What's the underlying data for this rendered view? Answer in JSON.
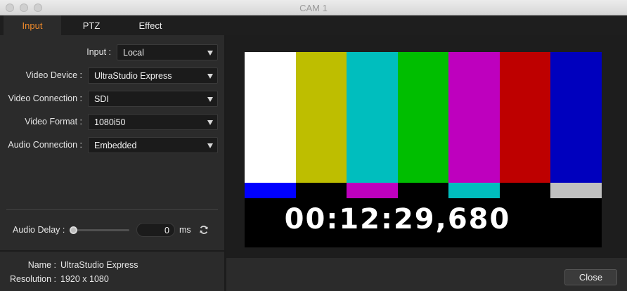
{
  "window": {
    "title": "CAM 1"
  },
  "tabs": [
    {
      "label": "Input",
      "active": true
    },
    {
      "label": "PTZ",
      "active": false
    },
    {
      "label": "Effect",
      "active": false
    }
  ],
  "form": {
    "input": {
      "label": "Input :",
      "value": "Local"
    },
    "video_device": {
      "label": "Video Device :",
      "value": "UltraStudio Express"
    },
    "video_connection": {
      "label": "Video Connection :",
      "value": "SDI"
    },
    "video_format": {
      "label": "Video Format :",
      "value": "1080i50"
    },
    "audio_connection": {
      "label": "Audio Connection :",
      "value": "Embedded"
    }
  },
  "audio_delay": {
    "label": "Audio Delay :",
    "value": "0",
    "unit": "ms"
  },
  "info": {
    "name_label": "Name :",
    "name_value": "UltraStudio Express",
    "resolution_label": "Resolution :",
    "resolution_value": "1920 x 1080"
  },
  "preview": {
    "timecode": "00:12:29,680",
    "top_bars": [
      "#ffffff",
      "#bebe00",
      "#00bebe",
      "#00be00",
      "#be00be",
      "#be0000",
      "#0000be"
    ],
    "bottom_bars": [
      "#0000ff",
      "#000000",
      "#be00be",
      "#000000",
      "#00bebe",
      "#000000",
      "#c0c0c0"
    ]
  },
  "buttons": {
    "close": "Close"
  },
  "colors": {
    "accent": "#f08a2a"
  }
}
